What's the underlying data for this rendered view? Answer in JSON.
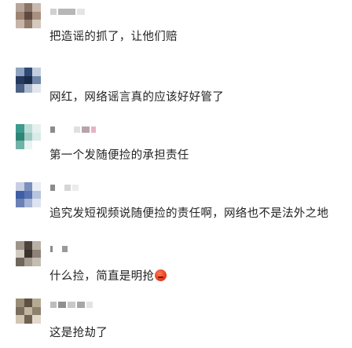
{
  "comments": [
    {
      "text": "把造谣的抓了，让他们赔"
    },
    {
      "text": "网红，网络谣言真的应该好好管了"
    },
    {
      "text": "第一个发随便捡的承担责任"
    },
    {
      "text": "追究发短视频说随便捡的责任啊，网络也不是法外之地"
    },
    {
      "text": "什么捡，简直是明抢",
      "emoji": "angry-face-icon"
    },
    {
      "text": "这是抢劫了"
    }
  ],
  "colors": {
    "text": "#222222",
    "background": "#ffffff"
  }
}
